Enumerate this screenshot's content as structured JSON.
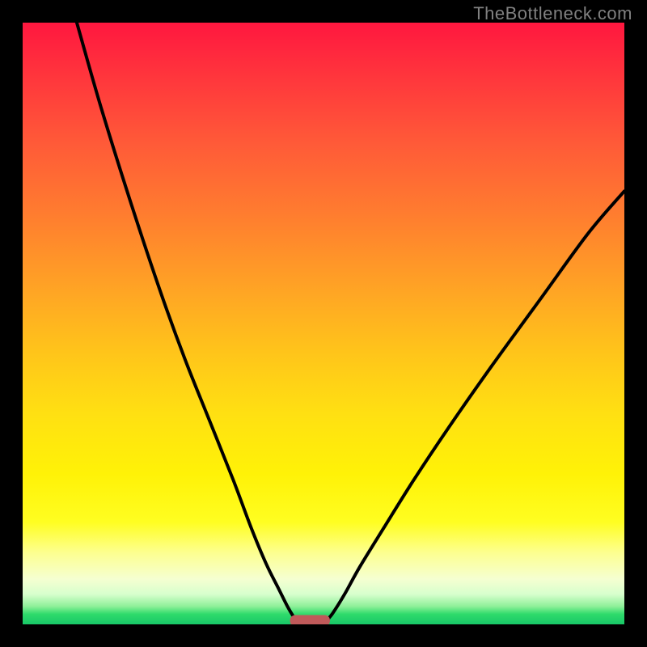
{
  "watermark": "TheBottleneck.com",
  "chart_data": {
    "type": "line",
    "title": "",
    "xlabel": "",
    "ylabel": "",
    "xlim": [
      0,
      100
    ],
    "ylim": [
      0,
      100
    ],
    "grid": false,
    "series": [
      {
        "name": "left-curve",
        "x": [
          9,
          13,
          18,
          23,
          27,
          31,
          35,
          38,
          40.5,
          42.5,
          44,
          45,
          45.7
        ],
        "y": [
          100,
          86,
          70,
          55,
          44,
          34,
          24,
          16,
          10,
          6,
          3,
          1.3,
          0.4
        ]
      },
      {
        "name": "right-curve",
        "x": [
          50.3,
          51.5,
          53.5,
          56,
          60,
          65,
          71,
          78,
          86,
          94,
          100
        ],
        "y": [
          0.4,
          1.8,
          5,
          9.5,
          16,
          24,
          33,
          43,
          54,
          65,
          72
        ]
      }
    ],
    "marker": {
      "name": "optimal-range",
      "x_start": 44.5,
      "x_end": 51,
      "y": 0,
      "color": "#c05a5a"
    },
    "background_gradient": {
      "top": "#ff173f",
      "mid": "#fff207",
      "bottom": "#18c767"
    }
  }
}
